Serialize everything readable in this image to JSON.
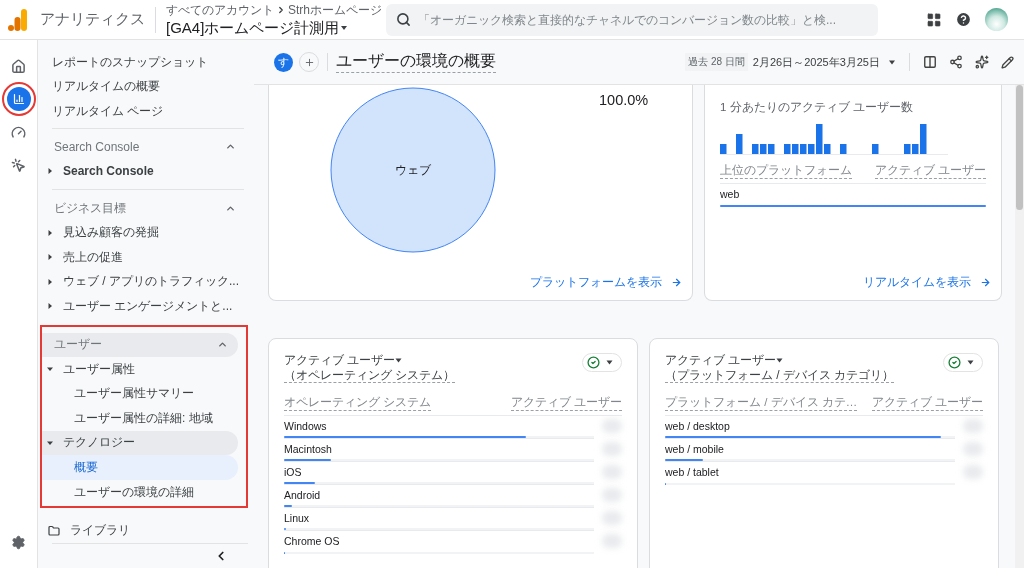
{
  "header": {
    "product": "アナリティクス",
    "breadcrumb": [
      "すべてのアカウント",
      "Strhホームページ"
    ],
    "property": "[GA4]ホームページ計測用",
    "search": {
      "placeholder": "「オーガニック検索と直接的なチャネルでのコンバージョン数の比較」と検..."
    }
  },
  "rail": [
    {
      "kind": "home",
      "selected": false,
      "highlighted": false
    },
    {
      "kind": "reports",
      "selected": true,
      "highlighted": true
    },
    {
      "kind": "explore",
      "selected": false,
      "highlighted": false
    },
    {
      "kind": "advertising",
      "selected": false,
      "highlighted": false
    }
  ],
  "nav": {
    "top_items": [
      {
        "label": "レポートのスナップショット",
        "selected": false
      },
      {
        "label": "リアルタイムの概要",
        "selected": false
      },
      {
        "label": "リアルタイム ページ",
        "selected": false
      }
    ],
    "sections": [
      {
        "title": "Search Console",
        "expanded": true,
        "highlighted": false,
        "items": [
          {
            "label": "Search Console",
            "expanded": false,
            "bold": true
          }
        ]
      },
      {
        "title": "ビジネス目標",
        "expanded": true,
        "highlighted": false,
        "items": [
          {
            "label": "見込み顧客の発掘",
            "expanded": false
          },
          {
            "label": "売上の促進",
            "expanded": false
          },
          {
            "label": "ウェブ / アプリのトラフィック...",
            "expanded": false
          },
          {
            "label": "ユーザー エンゲージメントと...",
            "expanded": false
          }
        ]
      },
      {
        "title": "ユーザー",
        "expanded": true,
        "highlighted": true,
        "items": [
          {
            "label": "ユーザー属性",
            "expanded": true,
            "children": [
              {
                "label": "ユーザー属性サマリー",
                "selected": false
              },
              {
                "label": "ユーザー属性の詳細: 地域",
                "selected": false
              }
            ]
          },
          {
            "label": "テクノロジー",
            "expanded": true,
            "children": [
              {
                "label": "概要",
                "selected": true
              },
              {
                "label": "ユーザーの環境の詳細",
                "selected": false
              }
            ]
          }
        ]
      }
    ],
    "library": "ライブラリ"
  },
  "page": {
    "comparison_chip": "す",
    "title": "ユーザーの環境の概要",
    "date_label": "過去 28 日間",
    "date_range": "2月26日～2025年3月25日"
  },
  "platform_card": {
    "chart_data": {
      "type": "pie",
      "categories": [
        "ウェブ"
      ],
      "values": [
        100
      ]
    },
    "percent": "100.0%",
    "link": "プラットフォームを表示"
  },
  "realtime_card": {
    "chart_title": "1 分あたりのアクティブ ユーザー数",
    "columns": [
      "上位のプラットフォーム",
      "アクティブ ユーザー"
    ],
    "rows": [
      {
        "label": "web",
        "level": 1
      }
    ],
    "link": "リアルタイムを表示"
  },
  "table_cards": [
    {
      "metric": "アクティブ ユーザー",
      "dimension": "（オペレーティング システム）",
      "columns": [
        "オペレーティング システム",
        "アクティブ ユーザー"
      ],
      "rows": [
        {
          "label": "Windows",
          "level": 0.78
        },
        {
          "label": "Macintosh",
          "level": 0.15
        },
        {
          "label": "iOS",
          "level": 0.1
        },
        {
          "label": "Android",
          "level": 0.025
        },
        {
          "label": "Linux",
          "level": 0.005
        },
        {
          "label": "Chrome OS",
          "level": 0.004
        }
      ]
    },
    {
      "metric": "アクティブ ユーザー",
      "dimension": "（プラットフォーム / デバイス カテゴリ）",
      "columns": [
        "プラットフォーム / デバイス カテ…",
        "アクティブ ユーザー"
      ],
      "rows": [
        {
          "label": "web / desktop",
          "level": 0.95
        },
        {
          "label": "web / mobile",
          "level": 0.13
        },
        {
          "label": "web / tablet",
          "level": 0.005
        }
      ]
    }
  ]
}
